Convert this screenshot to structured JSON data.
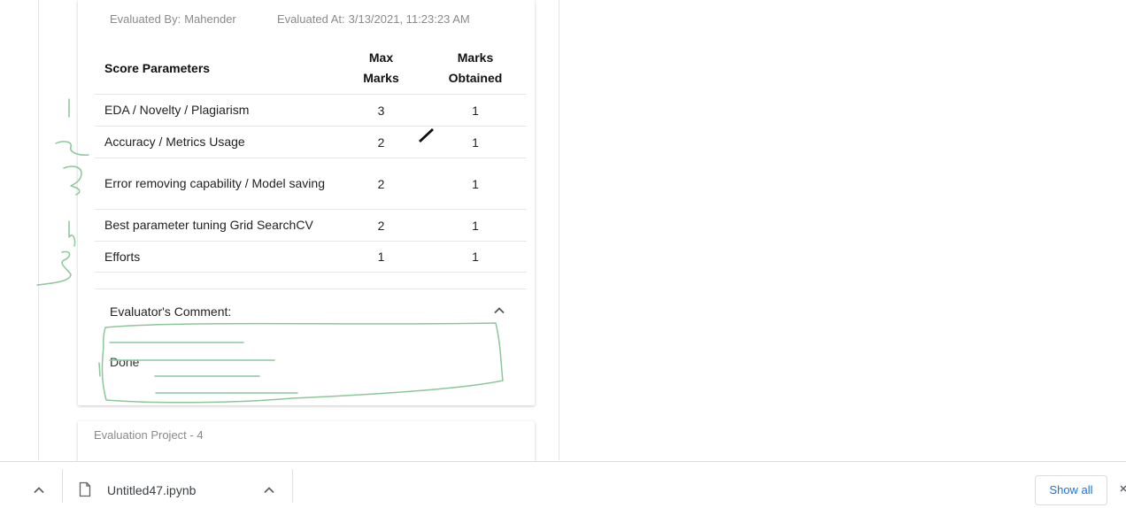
{
  "evaluation": {
    "evaluated_by_label": "Evaluated By:",
    "evaluated_by": "Mahender",
    "evaluated_at_label": "Evaluated At:",
    "evaluated_at": "3/13/2021, 11:23:23 AM",
    "table": {
      "headers": {
        "param": "Score Parameters",
        "max_line1": "Max",
        "max_line2": "Marks",
        "obtained_line1": "Marks",
        "obtained_line2": "Obtained"
      },
      "rows": [
        {
          "param": "EDA / Novelty / Plagiarism",
          "max": "3",
          "obtained": "1"
        },
        {
          "param": "Accuracy / Metrics Usage",
          "max": "2",
          "obtained": "1"
        },
        {
          "param": "Error removing capability / Model saving",
          "max": "2",
          "obtained": "1"
        },
        {
          "param": "Best parameter tuning Grid SearchCV",
          "max": "2",
          "obtained": "1"
        },
        {
          "param": "Efforts",
          "max": "1",
          "obtained": "1"
        }
      ]
    },
    "comment_label": "Evaluator's Comment:",
    "comment": "Done"
  },
  "next_card": {
    "title": "Evaluation Project - 4"
  },
  "download_bar": {
    "file_name": "Untitled47.ipynb",
    "show_all_label": "Show all"
  },
  "colors": {
    "annotation_green": "#8cc79a",
    "link_blue": "#1a73e8"
  },
  "icons": {
    "comment_toggle": "chevron-up-icon",
    "file": "file-icon",
    "file_menu": "chevron-up-icon",
    "downloads_expand": "chevron-up-icon",
    "close": "close-icon"
  }
}
